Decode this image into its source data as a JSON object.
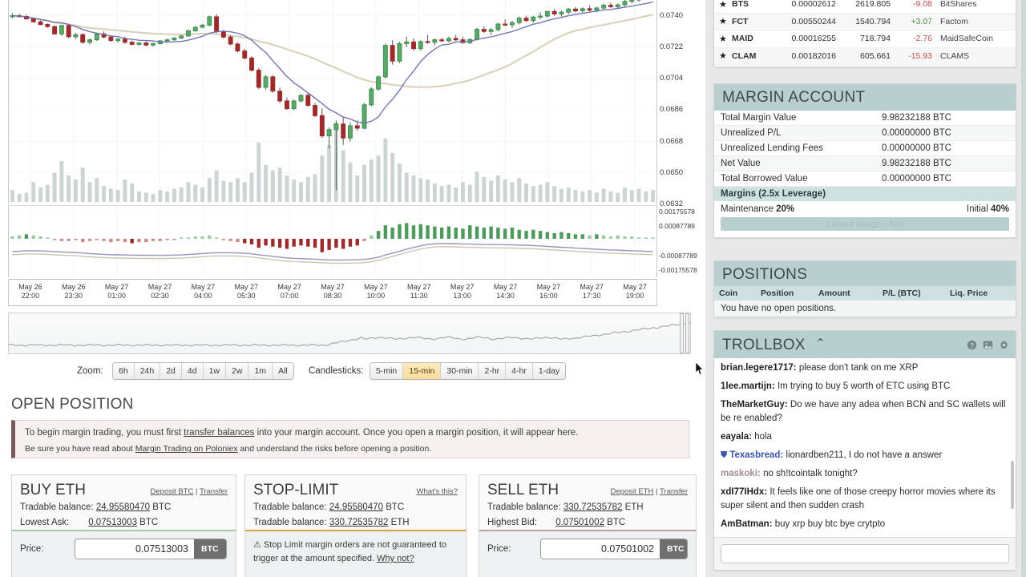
{
  "markets": {
    "columns": [
      "star",
      "code",
      "price",
      "volume",
      "change",
      "name"
    ],
    "rows": [
      {
        "star": "★",
        "code": "BTS",
        "price": "0.00002612",
        "volume": "2619.805",
        "change": "-9.08",
        "dir": "neg",
        "name": "BitShares"
      },
      {
        "star": "★",
        "code": "FCT",
        "price": "0.00550244",
        "volume": "1540.794",
        "change": "+3.07",
        "dir": "pos",
        "name": "Factom"
      },
      {
        "star": "★",
        "code": "MAID",
        "price": "0.00016255",
        "volume": "718.794",
        "change": "-2.76",
        "dir": "neg",
        "name": "MaidSafeCoin"
      },
      {
        "star": "★",
        "code": "CLAM",
        "price": "0.00182016",
        "volume": "605.661",
        "change": "-15.93",
        "dir": "neg",
        "name": "CLAMS"
      }
    ]
  },
  "margin_account": {
    "title": "MARGIN ACCOUNT",
    "rows": [
      {
        "label": "Total Margin Value",
        "value": "9.98232188 BTC"
      },
      {
        "label": "Unrealized P/L",
        "value": "0.00000000 BTC"
      },
      {
        "label": "Unrealized Lending Fees",
        "value": "0.00000000 BTC"
      },
      {
        "label": "Net Value",
        "value": "9.98232188 BTC"
      },
      {
        "label": "Total Borrowed Value",
        "value": "0.00000000 BTC"
      }
    ],
    "margins_bar": "Margins (2.5x Leverage)",
    "maintenance_label": "Maintenance",
    "maintenance_value": "20%",
    "initial_label": "Initial",
    "initial_value": "40%",
    "current_margin": "Current Margin - N/A"
  },
  "positions": {
    "title": "POSITIONS",
    "columns": [
      "Coin",
      "Position",
      "Amount",
      "P/L (BTC)",
      "Liq. Price"
    ],
    "empty_text": "You have no open positions."
  },
  "trollbox": {
    "title": "TROLLBOX",
    "caret": "⌃",
    "icons": [
      "help-icon",
      "image-icon",
      "gear-icon"
    ],
    "input_placeholder": "",
    "input_value": "",
    "messages": [
      {
        "user": "brian.legere1717",
        "style": "normal",
        "text": "please don't tank on me XRP"
      },
      {
        "user": "1lee.martijn",
        "style": "normal",
        "text": "Im trying to buy 5 worth of ETC using BTC"
      },
      {
        "user": "TheMarketGuy",
        "style": "normal",
        "text": "Do we have any adea when BCN and SC wallets will be re enabled?"
      },
      {
        "user": "eayala",
        "style": "normal",
        "text": "hola"
      },
      {
        "user": "Texasbread",
        "style": "mod",
        "badge": "⛊",
        "text": "lionardben211, I do not have a answer"
      },
      {
        "user": "maskoki",
        "style": "grey",
        "text": "no sh!tcointalk tonight?"
      },
      {
        "user": "xdI77IHdx",
        "style": "normal",
        "text": "It feels like one of those creepy horror movies where its super silent and then sudden crash"
      },
      {
        "user": "AmBatman",
        "style": "normal",
        "text": "buy xrp buy btc bye crytpto"
      }
    ]
  },
  "controls": {
    "zoom_label": "Zoom:",
    "zoom_options": [
      "6h",
      "24h",
      "2d",
      "4d",
      "1w",
      "2w",
      "1m",
      "All"
    ],
    "zoom_selected": "",
    "candles_label": "Candlesticks:",
    "candle_options": [
      "5-min",
      "15-min",
      "30-min",
      "2-hr",
      "4-hr",
      "1-day"
    ],
    "candle_selected": "15-min"
  },
  "open_position": {
    "title": "OPEN POSITION",
    "notice_line1_a": "To begin margin trading, you must first ",
    "notice_link1": "transfer balances",
    "notice_line1_b": " into your margin account. Once you open a margin position, it will appear here.",
    "notice_line2_a": "Be sure you have read about ",
    "notice_link2": "Margin Trading on Poloniex",
    "notice_line2_b": " and understand the risks before opening a position."
  },
  "buy_panel": {
    "title": "BUY ETH",
    "link_deposit": "Deposit BTC",
    "link_sep": " | ",
    "link_transfer": "Transfer",
    "row1_label": "Tradable balance:",
    "row1_value": "24.95580470",
    "row1_unit": "BTC",
    "row2_label": "Lowest Ask:",
    "row2_value": "0.07513003",
    "row2_unit": "BTC",
    "price_label": "Price:",
    "price_value": "0.07513003",
    "price_unit": "BTC"
  },
  "stop_panel": {
    "title": "STOP-LIMIT",
    "link_whats": "What's this?",
    "row1_label": "Tradable balance:",
    "row1_value": "24.95580470",
    "row1_unit": "BTC",
    "row2_label": "Tradable balance:",
    "row2_value": "330.72535782",
    "row2_unit": "ETH",
    "warn_icon": "⚠",
    "warn_text": " Stop Limit margin orders are not guaranteed to trigger at the amount specified. ",
    "warn_link": "Why not?"
  },
  "sell_panel": {
    "title": "SELL ETH",
    "link_deposit": "Deposit ETH",
    "link_sep": " | ",
    "link_transfer": "Transfer",
    "row1_label": "Tradable balance:",
    "row1_value": "330.72535782",
    "row1_unit": "ETH",
    "row2_label": "Highest Bid:",
    "row2_value": "0.07501002",
    "row2_unit": "BTC",
    "price_label": "Price:",
    "price_value": "0.07501002",
    "price_unit": "BTC"
  },
  "chart_data": {
    "type": "line",
    "title": "",
    "xlabel": "",
    "ylabel": "",
    "price_axis_ticks": [
      "0.0740",
      "0.0722",
      "0.0704",
      "0.0686",
      "0.0668",
      "0.0650",
      "0.0632"
    ],
    "price_ylim": [
      0.0632,
      0.0749
    ],
    "macd_axis_ticks": [
      "0.00175578",
      "0.00087789",
      "-0.00087789",
      "-0.00175578"
    ],
    "macd_ylim": [
      -0.00215,
      0.00215
    ],
    "time_ticks": [
      {
        "date": "May 26",
        "time": "22:00"
      },
      {
        "date": "May 26",
        "time": "23:30"
      },
      {
        "date": "May 27",
        "time": "01:00"
      },
      {
        "date": "May 27",
        "time": "02:30"
      },
      {
        "date": "May 27",
        "time": "04:00"
      },
      {
        "date": "May 27",
        "time": "05:30"
      },
      {
        "date": "May 27",
        "time": "07:00"
      },
      {
        "date": "May 27",
        "time": "08:30"
      },
      {
        "date": "May 27",
        "time": "10:00"
      },
      {
        "date": "May 27",
        "time": "11:30"
      },
      {
        "date": "May 27",
        "time": "13:00"
      },
      {
        "date": "May 27",
        "time": "14:30"
      },
      {
        "date": "May 27",
        "time": "16:00"
      },
      {
        "date": "May 27",
        "time": "17:30"
      },
      {
        "date": "May 27",
        "time": "19:00"
      }
    ],
    "colors": {
      "up": "#3f8f4f",
      "down": "#9e2b2b",
      "volume": "#c3cccc",
      "ma_fast": "#6b6fb0",
      "ma_slow": "#d8d0b8"
    },
    "candles": [
      {
        "o": 0.07395,
        "h": 0.07415,
        "l": 0.07385,
        "c": 0.074,
        "v": 18
      },
      {
        "o": 0.074,
        "h": 0.07412,
        "l": 0.0739,
        "c": 0.07396,
        "v": 12
      },
      {
        "o": 0.07396,
        "h": 0.07405,
        "l": 0.07378,
        "c": 0.07382,
        "v": 14
      },
      {
        "o": 0.07382,
        "h": 0.0739,
        "l": 0.0736,
        "c": 0.07365,
        "v": 30
      },
      {
        "o": 0.07365,
        "h": 0.07372,
        "l": 0.07345,
        "c": 0.0735,
        "v": 22
      },
      {
        "o": 0.0735,
        "h": 0.07356,
        "l": 0.0733,
        "c": 0.07338,
        "v": 26
      },
      {
        "o": 0.07338,
        "h": 0.07344,
        "l": 0.0729,
        "c": 0.07296,
        "v": 44
      },
      {
        "o": 0.07296,
        "h": 0.0735,
        "l": 0.07285,
        "c": 0.07344,
        "v": 62
      },
      {
        "o": 0.07344,
        "h": 0.07352,
        "l": 0.0727,
        "c": 0.0728,
        "v": 40
      },
      {
        "o": 0.0728,
        "h": 0.073,
        "l": 0.07266,
        "c": 0.07292,
        "v": 34
      },
      {
        "o": 0.07292,
        "h": 0.073,
        "l": 0.0724,
        "c": 0.07248,
        "v": 52
      },
      {
        "o": 0.07248,
        "h": 0.0727,
        "l": 0.07235,
        "c": 0.07262,
        "v": 30
      },
      {
        "o": 0.07262,
        "h": 0.073,
        "l": 0.07256,
        "c": 0.07296,
        "v": 36
      },
      {
        "o": 0.07296,
        "h": 0.0731,
        "l": 0.0727,
        "c": 0.07278,
        "v": 24
      },
      {
        "o": 0.07278,
        "h": 0.07288,
        "l": 0.0725,
        "c": 0.07258,
        "v": 20
      },
      {
        "o": 0.07258,
        "h": 0.07272,
        "l": 0.07246,
        "c": 0.07266,
        "v": 18
      },
      {
        "o": 0.07266,
        "h": 0.0728,
        "l": 0.0724,
        "c": 0.07248,
        "v": 34
      },
      {
        "o": 0.07248,
        "h": 0.07258,
        "l": 0.0723,
        "c": 0.07236,
        "v": 28
      },
      {
        "o": 0.07236,
        "h": 0.0725,
        "l": 0.07228,
        "c": 0.07244,
        "v": 16
      },
      {
        "o": 0.07244,
        "h": 0.07252,
        "l": 0.07226,
        "c": 0.07232,
        "v": 14
      },
      {
        "o": 0.07232,
        "h": 0.07246,
        "l": 0.07225,
        "c": 0.0724,
        "v": 12
      },
      {
        "o": 0.0724,
        "h": 0.0726,
        "l": 0.07236,
        "c": 0.07256,
        "v": 18
      },
      {
        "o": 0.07256,
        "h": 0.07268,
        "l": 0.0725,
        "c": 0.07262,
        "v": 16
      },
      {
        "o": 0.07262,
        "h": 0.07278,
        "l": 0.07256,
        "c": 0.07272,
        "v": 20
      },
      {
        "o": 0.07272,
        "h": 0.0729,
        "l": 0.07266,
        "c": 0.07284,
        "v": 22
      },
      {
        "o": 0.07284,
        "h": 0.0732,
        "l": 0.0728,
        "c": 0.07314,
        "v": 30
      },
      {
        "o": 0.07314,
        "h": 0.0734,
        "l": 0.07308,
        "c": 0.07334,
        "v": 26
      },
      {
        "o": 0.07334,
        "h": 0.07352,
        "l": 0.07328,
        "c": 0.07346,
        "v": 22
      },
      {
        "o": 0.07346,
        "h": 0.074,
        "l": 0.0734,
        "c": 0.07394,
        "v": 36
      },
      {
        "o": 0.07394,
        "h": 0.07408,
        "l": 0.073,
        "c": 0.0731,
        "v": 48
      },
      {
        "o": 0.0731,
        "h": 0.0732,
        "l": 0.0727,
        "c": 0.07278,
        "v": 32
      },
      {
        "o": 0.07278,
        "h": 0.07288,
        "l": 0.0723,
        "c": 0.07238,
        "v": 30
      },
      {
        "o": 0.07238,
        "h": 0.07248,
        "l": 0.0719,
        "c": 0.07198,
        "v": 36
      },
      {
        "o": 0.07198,
        "h": 0.0721,
        "l": 0.0715,
        "c": 0.07158,
        "v": 30
      },
      {
        "o": 0.07158,
        "h": 0.07168,
        "l": 0.0708,
        "c": 0.07088,
        "v": 44
      },
      {
        "o": 0.07088,
        "h": 0.071,
        "l": 0.0698,
        "c": 0.0699,
        "v": 90
      },
      {
        "o": 0.0699,
        "h": 0.0706,
        "l": 0.06975,
        "c": 0.0705,
        "v": 56
      },
      {
        "o": 0.0705,
        "h": 0.0706,
        "l": 0.0696,
        "c": 0.06968,
        "v": 48
      },
      {
        "o": 0.06968,
        "h": 0.0699,
        "l": 0.069,
        "c": 0.06912,
        "v": 52
      },
      {
        "o": 0.06912,
        "h": 0.0693,
        "l": 0.0686,
        "c": 0.06868,
        "v": 40
      },
      {
        "o": 0.06868,
        "h": 0.0692,
        "l": 0.0686,
        "c": 0.06912,
        "v": 34
      },
      {
        "o": 0.06912,
        "h": 0.0695,
        "l": 0.06905,
        "c": 0.06944,
        "v": 30
      },
      {
        "o": 0.06944,
        "h": 0.0696,
        "l": 0.0688,
        "c": 0.06886,
        "v": 38
      },
      {
        "o": 0.06886,
        "h": 0.069,
        "l": 0.0682,
        "c": 0.06828,
        "v": 42
      },
      {
        "o": 0.06828,
        "h": 0.0687,
        "l": 0.067,
        "c": 0.06712,
        "v": 70
      },
      {
        "o": 0.06712,
        "h": 0.0676,
        "l": 0.0664,
        "c": 0.06748,
        "v": 86
      },
      {
        "o": 0.06748,
        "h": 0.068,
        "l": 0.064,
        "c": 0.0678,
        "v": 120
      },
      {
        "o": 0.0678,
        "h": 0.0682,
        "l": 0.0666,
        "c": 0.067,
        "v": 78
      },
      {
        "o": 0.067,
        "h": 0.0679,
        "l": 0.0668,
        "c": 0.0677,
        "v": 60
      },
      {
        "o": 0.0677,
        "h": 0.068,
        "l": 0.0674,
        "c": 0.06756,
        "v": 40
      },
      {
        "o": 0.06756,
        "h": 0.069,
        "l": 0.0675,
        "c": 0.0689,
        "v": 56
      },
      {
        "o": 0.0689,
        "h": 0.0699,
        "l": 0.0688,
        "c": 0.0698,
        "v": 64
      },
      {
        "o": 0.0698,
        "h": 0.0706,
        "l": 0.0697,
        "c": 0.0705,
        "v": 70
      },
      {
        "o": 0.0705,
        "h": 0.0724,
        "l": 0.0704,
        "c": 0.0723,
        "v": 96
      },
      {
        "o": 0.0723,
        "h": 0.0726,
        "l": 0.0712,
        "c": 0.0714,
        "v": 74
      },
      {
        "o": 0.0714,
        "h": 0.0725,
        "l": 0.0713,
        "c": 0.0724,
        "v": 58
      },
      {
        "o": 0.0724,
        "h": 0.0728,
        "l": 0.0722,
        "c": 0.0725,
        "v": 44
      },
      {
        "o": 0.0725,
        "h": 0.0727,
        "l": 0.072,
        "c": 0.07212,
        "v": 40
      },
      {
        "o": 0.07212,
        "h": 0.0726,
        "l": 0.072,
        "c": 0.07252,
        "v": 36
      },
      {
        "o": 0.07252,
        "h": 0.0729,
        "l": 0.0724,
        "c": 0.07248,
        "v": 34
      },
      {
        "o": 0.07248,
        "h": 0.0727,
        "l": 0.0723,
        "c": 0.07262,
        "v": 28
      },
      {
        "o": 0.07262,
        "h": 0.07275,
        "l": 0.0725,
        "c": 0.07256,
        "v": 24
      },
      {
        "o": 0.07256,
        "h": 0.0728,
        "l": 0.07248,
        "c": 0.0727,
        "v": 26
      },
      {
        "o": 0.0727,
        "h": 0.0729,
        "l": 0.07255,
        "c": 0.07262,
        "v": 22
      },
      {
        "o": 0.07262,
        "h": 0.0728,
        "l": 0.0724,
        "c": 0.07246,
        "v": 30
      },
      {
        "o": 0.07246,
        "h": 0.0727,
        "l": 0.07238,
        "c": 0.07264,
        "v": 26
      },
      {
        "o": 0.07264,
        "h": 0.0733,
        "l": 0.07258,
        "c": 0.07322,
        "v": 46
      },
      {
        "o": 0.07322,
        "h": 0.0734,
        "l": 0.073,
        "c": 0.0731,
        "v": 38
      },
      {
        "o": 0.0731,
        "h": 0.0733,
        "l": 0.0729,
        "c": 0.0732,
        "v": 32
      },
      {
        "o": 0.0732,
        "h": 0.0736,
        "l": 0.0731,
        "c": 0.07352,
        "v": 40
      },
      {
        "o": 0.07352,
        "h": 0.0738,
        "l": 0.0734,
        "c": 0.07348,
        "v": 34
      },
      {
        "o": 0.07348,
        "h": 0.0737,
        "l": 0.0733,
        "c": 0.0736,
        "v": 30
      },
      {
        "o": 0.0736,
        "h": 0.07395,
        "l": 0.0735,
        "c": 0.07386,
        "v": 36
      },
      {
        "o": 0.07386,
        "h": 0.074,
        "l": 0.07365,
        "c": 0.07372,
        "v": 28
      },
      {
        "o": 0.07372,
        "h": 0.074,
        "l": 0.0736,
        "c": 0.07392,
        "v": 24
      },
      {
        "o": 0.07392,
        "h": 0.0742,
        "l": 0.0738,
        "c": 0.07398,
        "v": 26
      },
      {
        "o": 0.07398,
        "h": 0.0743,
        "l": 0.0739,
        "c": 0.07424,
        "v": 30
      },
      {
        "o": 0.07424,
        "h": 0.0744,
        "l": 0.074,
        "c": 0.0741,
        "v": 24
      },
      {
        "o": 0.0741,
        "h": 0.0743,
        "l": 0.07395,
        "c": 0.0742,
        "v": 20
      },
      {
        "o": 0.0742,
        "h": 0.07445,
        "l": 0.0741,
        "c": 0.07438,
        "v": 22
      },
      {
        "o": 0.07438,
        "h": 0.0745,
        "l": 0.0742,
        "c": 0.07428,
        "v": 18
      },
      {
        "o": 0.07428,
        "h": 0.07448,
        "l": 0.07415,
        "c": 0.0744,
        "v": 16
      },
      {
        "o": 0.0744,
        "h": 0.0746,
        "l": 0.07425,
        "c": 0.07432,
        "v": 18
      },
      {
        "o": 0.07432,
        "h": 0.0745,
        "l": 0.0742,
        "c": 0.07444,
        "v": 14
      },
      {
        "o": 0.07444,
        "h": 0.0747,
        "l": 0.07435,
        "c": 0.0746,
        "v": 20
      },
      {
        "o": 0.0746,
        "h": 0.07475,
        "l": 0.07445,
        "c": 0.07452,
        "v": 16
      },
      {
        "o": 0.07452,
        "h": 0.0747,
        "l": 0.0744,
        "c": 0.07462,
        "v": 14
      },
      {
        "o": 0.07462,
        "h": 0.0749,
        "l": 0.07455,
        "c": 0.07482,
        "v": 22
      },
      {
        "o": 0.07482,
        "h": 0.075,
        "l": 0.0747,
        "c": 0.0749,
        "v": 18
      },
      {
        "o": 0.0749,
        "h": 0.0751,
        "l": 0.0748,
        "c": 0.075,
        "v": 20
      },
      {
        "o": 0.075,
        "h": 0.0752,
        "l": 0.0749,
        "c": 0.07508,
        "v": 16
      },
      {
        "o": 0.07508,
        "h": 0.07525,
        "l": 0.07495,
        "c": 0.07513,
        "v": 18
      }
    ],
    "macd_hist": [
      2,
      3,
      4,
      3,
      2,
      1,
      -1,
      -2,
      -2,
      -1,
      -3,
      -2,
      -1,
      -2,
      -3,
      -2,
      -3,
      -4,
      -3,
      -3,
      -2,
      -2,
      -1,
      -1,
      0,
      1,
      2,
      2,
      3,
      1,
      -1,
      -2,
      -3,
      -4,
      -5,
      -8,
      -6,
      -7,
      -8,
      -9,
      -7,
      -6,
      -7,
      -8,
      -12,
      -10,
      -8,
      -9,
      -7,
      -6,
      -2,
      3,
      7,
      12,
      10,
      13,
      14,
      12,
      13,
      12,
      11,
      10,
      11,
      10,
      9,
      12,
      11,
      10,
      11,
      10,
      9,
      10,
      8,
      7,
      8,
      7,
      6,
      5,
      6,
      5,
      4,
      4,
      3,
      4,
      3,
      2,
      3,
      2,
      2,
      1,
      1,
      1
    ]
  }
}
